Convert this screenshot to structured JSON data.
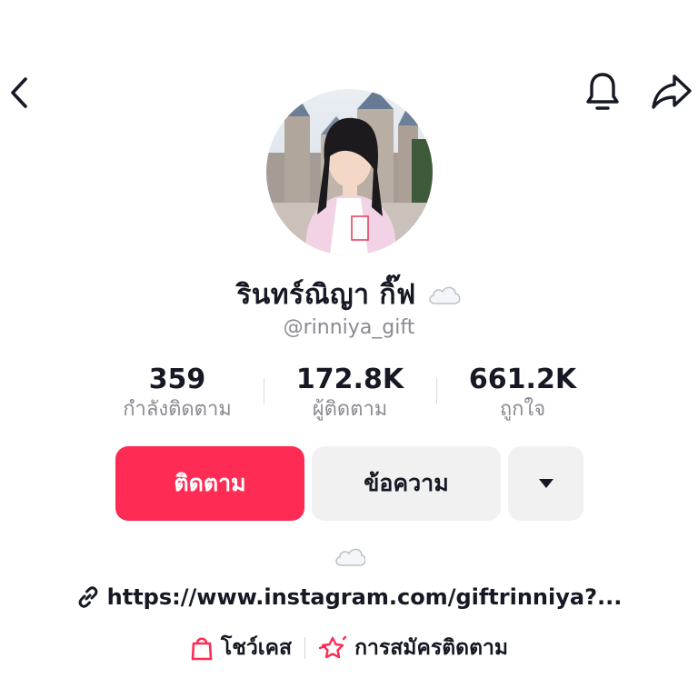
{
  "header": {
    "back_icon": "chevron-left-icon",
    "notification_icon": "bell-icon",
    "share_icon": "share-arrow-icon"
  },
  "profile": {
    "display_name": "รินทร์ณิญา กิ๊ฟ",
    "name_emoji": "cloud-emoji",
    "username": "@rinniya_gift"
  },
  "stats": [
    {
      "value": "359",
      "label": "กำลังติดตาม"
    },
    {
      "value": "172.8K",
      "label": "ผู้ติดตาม"
    },
    {
      "value": "661.2K",
      "label": "ถูกใจ"
    }
  ],
  "actions": {
    "follow_label": "ติดตาม",
    "message_label": "ข้อความ",
    "more_icon": "caret-down-icon"
  },
  "bio": {
    "emoji": "cloud-emoji",
    "link_icon": "link-icon",
    "link": "https://www.instagram.com/giftrinniya?..."
  },
  "features": [
    {
      "icon": "shopping-bag-icon",
      "label": "โชว์เคส"
    },
    {
      "icon": "subscription-star-icon",
      "label": "การสมัครติดตาม"
    }
  ],
  "colors": {
    "primary": "#fe2c55",
    "text": "#161823",
    "secondary_text": "#8a8b91",
    "button_gray": "#f1f1f2"
  }
}
